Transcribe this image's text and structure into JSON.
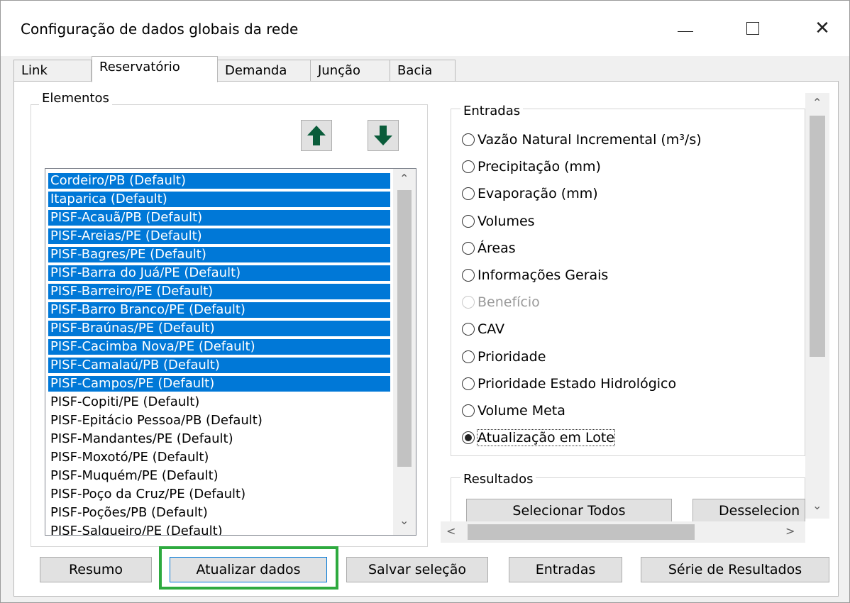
{
  "window": {
    "title": "Configuração de dados globais da rede",
    "minimize_glyph": "—",
    "maximize_glyph": "☐",
    "close_glyph": "✕"
  },
  "tabs": [
    {
      "label": "Link",
      "active": false
    },
    {
      "label": "Reservatório",
      "active": true
    },
    {
      "label": "Demanda",
      "active": false
    },
    {
      "label": "Junção",
      "active": false
    },
    {
      "label": "Bacia",
      "active": false
    }
  ],
  "elementos": {
    "label": "Elementos",
    "move_up_icon": "arrow-up-icon",
    "move_down_icon": "arrow-down-icon",
    "items": [
      {
        "label": "Cordeiro/PB (Default)",
        "selected": true
      },
      {
        "label": "Itaparica (Default)",
        "selected": true
      },
      {
        "label": "PISF-Acauã/PB (Default)",
        "selected": true
      },
      {
        "label": "PISF-Areias/PE (Default)",
        "selected": true
      },
      {
        "label": "PISF-Bagres/PE (Default)",
        "selected": true
      },
      {
        "label": "PISF-Barra do Juá/PE (Default)",
        "selected": true
      },
      {
        "label": "PISF-Barreiro/PE (Default)",
        "selected": true
      },
      {
        "label": "PISF-Barro Branco/PE (Default)",
        "selected": true
      },
      {
        "label": "PISF-Braúnas/PE (Default)",
        "selected": true
      },
      {
        "label": "PISF-Cacimba Nova/PE (Default)",
        "selected": true
      },
      {
        "label": "PISF-Camalaú/PB (Default)",
        "selected": true
      },
      {
        "label": "PISF-Campos/PE (Default)",
        "selected": true
      },
      {
        "label": "PISF-Copiti/PE (Default)",
        "selected": false
      },
      {
        "label": "PISF-Epitácio Pessoa/PB (Default)",
        "selected": false
      },
      {
        "label": "PISF-Mandantes/PE (Default)",
        "selected": false
      },
      {
        "label": "PISF-Moxotó/PE (Default)",
        "selected": false
      },
      {
        "label": "PISF-Muquém/PE (Default)",
        "selected": false
      },
      {
        "label": "PISF-Poço da Cruz/PE (Default)",
        "selected": false
      },
      {
        "label": "PISF-Poções/PB (Default)",
        "selected": false
      },
      {
        "label": "PISF-Salgueiro/PE (Default)",
        "selected": false
      }
    ]
  },
  "entradas": {
    "label": "Entradas",
    "options": [
      {
        "label": "Vazão Natural Incremental (m³/s)",
        "checked": false,
        "disabled": false
      },
      {
        "label": "Precipitação (mm)",
        "checked": false,
        "disabled": false
      },
      {
        "label": "Evaporação (mm)",
        "checked": false,
        "disabled": false
      },
      {
        "label": "Volumes",
        "checked": false,
        "disabled": false
      },
      {
        "label": "Áreas",
        "checked": false,
        "disabled": false
      },
      {
        "label": "Informações Gerais",
        "checked": false,
        "disabled": false
      },
      {
        "label": "Benefício",
        "checked": false,
        "disabled": true
      },
      {
        "label": "CAV",
        "checked": false,
        "disabled": false
      },
      {
        "label": "Prioridade",
        "checked": false,
        "disabled": false
      },
      {
        "label": "Prioridade Estado Hidrológico",
        "checked": false,
        "disabled": false
      },
      {
        "label": "Volume Meta",
        "checked": false,
        "disabled": false
      },
      {
        "label": "Atualização em Lote",
        "checked": true,
        "disabled": false
      }
    ]
  },
  "resultados": {
    "label": "Resultados",
    "select_all": "Selecionar Todos",
    "deselect_all": "Desselecion"
  },
  "buttons": {
    "resumo": "Resumo",
    "atualizar": "Atualizar dados",
    "salvar": "Salvar seleção",
    "entradas": "Entradas",
    "serie": "Série de Resultados"
  },
  "scroll_glyphs": {
    "up": "⌃",
    "down": "⌄",
    "left": "<",
    "right": ">"
  },
  "colors": {
    "selection": "#0078d7",
    "highlight": "#2eaa3f",
    "arrow": "#0a5c3a"
  }
}
